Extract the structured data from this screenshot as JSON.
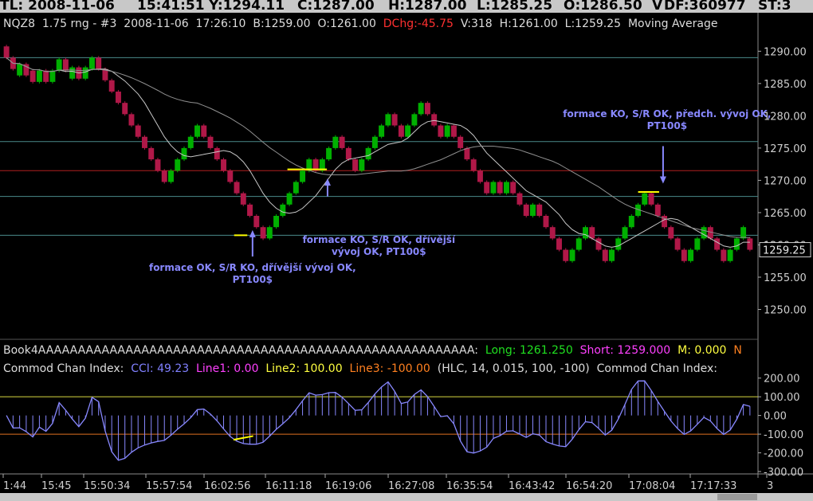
{
  "titlebar": {
    "segments": [
      {
        "text": "TL: 2008-11-06",
        "x": 0
      },
      {
        "text": "15:41:51",
        "x": 172
      },
      {
        "text": "Y:1294.11",
        "x": 262
      },
      {
        "text": "C:1287.00",
        "x": 373
      },
      {
        "text": "H:1287.00",
        "x": 487
      },
      {
        "text": "L:1285.25",
        "x": 598
      },
      {
        "text": "O:1286.50",
        "x": 707
      },
      {
        "text": "V",
        "x": 818
      },
      {
        "text": "DF:360977",
        "x": 833
      },
      {
        "text": "ST:3",
        "x": 951
      }
    ]
  },
  "price_header": {
    "items": [
      {
        "text": "NQZ8",
        "color": "#dddddd"
      },
      {
        "text": "1.75 rng - #3",
        "color": "#dddddd"
      },
      {
        "text": "2008-11-06",
        "color": "#dddddd"
      },
      {
        "text": "17:26:10",
        "color": "#dddddd"
      },
      {
        "text": "B:1259.00",
        "color": "#dddddd"
      },
      {
        "text": "O:1261.00",
        "color": "#dddddd"
      },
      {
        "text": "DChg:-45.75",
        "color": "#ff3030"
      },
      {
        "text": "V:318",
        "color": "#dddddd"
      },
      {
        "text": "H:1261.00",
        "color": "#dddddd"
      },
      {
        "text": "L:1259.25",
        "color": "#dddddd"
      },
      {
        "text": "Moving Average",
        "color": "#dddddd"
      }
    ]
  },
  "book_header": {
    "items": [
      {
        "text": "Book4AAAAAAAAAAAAAAAAAAAAAAAAAAAAAAAAAAAAAAAAAAAAAAAAAAAAAAA:",
        "color": "#dddddd"
      },
      {
        "text": "Long: 1261.250",
        "color": "#20e020"
      },
      {
        "text": "Short: 1259.000",
        "color": "#ff40ff"
      },
      {
        "text": "M: 0.000",
        "color": "#ffff40"
      },
      {
        "text": "N",
        "color": "#ff8020"
      }
    ]
  },
  "cci_header": {
    "items": [
      {
        "text": "Commod Chan Index:",
        "color": "#dddddd"
      },
      {
        "text": "CCI: 49.23",
        "color": "#8080ff"
      },
      {
        "text": "Line1: 0.00",
        "color": "#ff40ff"
      },
      {
        "text": "Line2: 100.00",
        "color": "#ffff40"
      },
      {
        "text": "Line3: -100.00",
        "color": "#ff8020"
      },
      {
        "text": "(HLC, 14, 0.015, 100, -100)",
        "color": "#dddddd"
      },
      {
        "text": "Commod Chan Index:",
        "color": "#dddddd"
      }
    ]
  },
  "current_price_label": "1259.25",
  "colors": {
    "up_bar": "#00b000",
    "down_bar": "#b01848",
    "ma_fast": "#c8c8c8",
    "ma_slow": "#909090",
    "cci_line": "#8888ff",
    "annotation_text": "#8888ff",
    "arrow": "#8888ff",
    "highlight": "#ffff00",
    "hline_teal": "#4a8a8a",
    "hline_red": "#b02020",
    "cci_upper": "#d8d840",
    "cci_lower": "#e07020"
  },
  "annotations": [
    {
      "lines": [
        "formace OK, S/R KO, dřívější vývoj OK,",
        "PT100$"
      ],
      "bar": 37.4,
      "price": 1256.0,
      "arrow_tip_price": 1262.3,
      "arrow_tail_price": 1258.2
    },
    {
      "lines": [
        "formace KO, S/R OK, dřívější",
        "vývoj OK, PT100$"
      ],
      "bar": 56.6,
      "price": 1260.3,
      "arrow_tip_price": 1270.3,
      "arrow_tail_price": 1267.5
    },
    {
      "lines": [
        "formace KO, S/R OK, předch. vývoj OK,",
        "PT100$"
      ],
      "bar": 100.4,
      "price": 1279.8,
      "arrow_tip_price": 1269.5,
      "arrow_tail_price": 1275.3
    }
  ],
  "chart_data": {
    "type": "bar",
    "price_axis": {
      "min": 1245.5,
      "max": 1293.0,
      "ticks": [
        "1290.00",
        "1285.00",
        "1280.00",
        "1275.00",
        "1270.00",
        "1265.00",
        "1260.00",
        "1255.00",
        "1250.00"
      ]
    },
    "time_axis": {
      "labels": [
        "1:44",
        "15:45",
        "15:50:34",
        "15:57:54",
        "16:02:56",
        "16:11:18",
        "16:19:06",
        "16:27:08",
        "16:35:54",
        "16:43:42",
        "16:54:20",
        "17:08:04",
        "17:17:33",
        "3"
      ]
    },
    "horizontal_levels": [
      {
        "price": 1289.0,
        "color": "#4a8a8a"
      },
      {
        "price": 1276.0,
        "color": "#4a8a8a"
      },
      {
        "price": 1271.5,
        "color": "#b02020"
      },
      {
        "price": 1267.5,
        "color": "#4a8a8a"
      },
      {
        "price": 1261.5,
        "color": "#4a8a8a"
      }
    ],
    "highlights": [
      {
        "bar_from": 34.6,
        "bar_to": 36.6,
        "price": 1261.5
      },
      {
        "bar_from": 42.7,
        "bar_to": 48.7,
        "price": 1271.7
      },
      {
        "bar_from": 96.0,
        "bar_to": 99.2,
        "price": 1268.2
      }
    ],
    "closes": [
      1289,
      1287.25,
      1288,
      1286.25,
      1285.25,
      1287,
      1285.25,
      1287,
      1288.75,
      1287,
      1287.5,
      1285.75,
      1287.5,
      1289,
      1287.25,
      1285.5,
      1283.75,
      1282,
      1280.25,
      1278.5,
      1276.75,
      1275,
      1273.25,
      1271.5,
      1269.75,
      1271.5,
      1273.25,
      1275,
      1276.75,
      1278.5,
      1276.75,
      1275,
      1273.25,
      1271.5,
      1269.75,
      1268,
      1266.25,
      1264.5,
      1262.75,
      1261,
      1262.75,
      1264.5,
      1266.25,
      1268,
      1269.75,
      1271.5,
      1273.25,
      1271.5,
      1273.25,
      1275,
      1276.75,
      1275,
      1273.25,
      1271.5,
      1273.25,
      1275,
      1276.75,
      1278.5,
      1280.25,
      1278.5,
      1276.75,
      1278.5,
      1280.25,
      1282,
      1280.25,
      1278.5,
      1276.75,
      1278.5,
      1276.75,
      1275,
      1273.25,
      1271.5,
      1269.75,
      1268,
      1269.75,
      1268,
      1269.75,
      1268,
      1266.25,
      1264.5,
      1266.25,
      1264.5,
      1262.75,
      1261,
      1259.25,
      1257.5,
      1259.25,
      1261,
      1262.75,
      1261,
      1259.25,
      1257.5,
      1259.25,
      1261,
      1262.75,
      1264.5,
      1266.25,
      1268,
      1266.25,
      1264.5,
      1262.75,
      1261,
      1259.25,
      1257.5,
      1259.25,
      1261,
      1262.75,
      1261,
      1259.25,
      1257.5,
      1259.25,
      1261,
      1262.75,
      1259.25
    ],
    "cci": {
      "ylim": [
        -300,
        220
      ],
      "ticks": [
        "200.00",
        "100.00",
        "0.00",
        "-100.00",
        "-200.00",
        "-300.00"
      ],
      "levels": {
        "upper": 100,
        "zero": 0,
        "lower": -100
      },
      "last_value": 49.23
    }
  }
}
